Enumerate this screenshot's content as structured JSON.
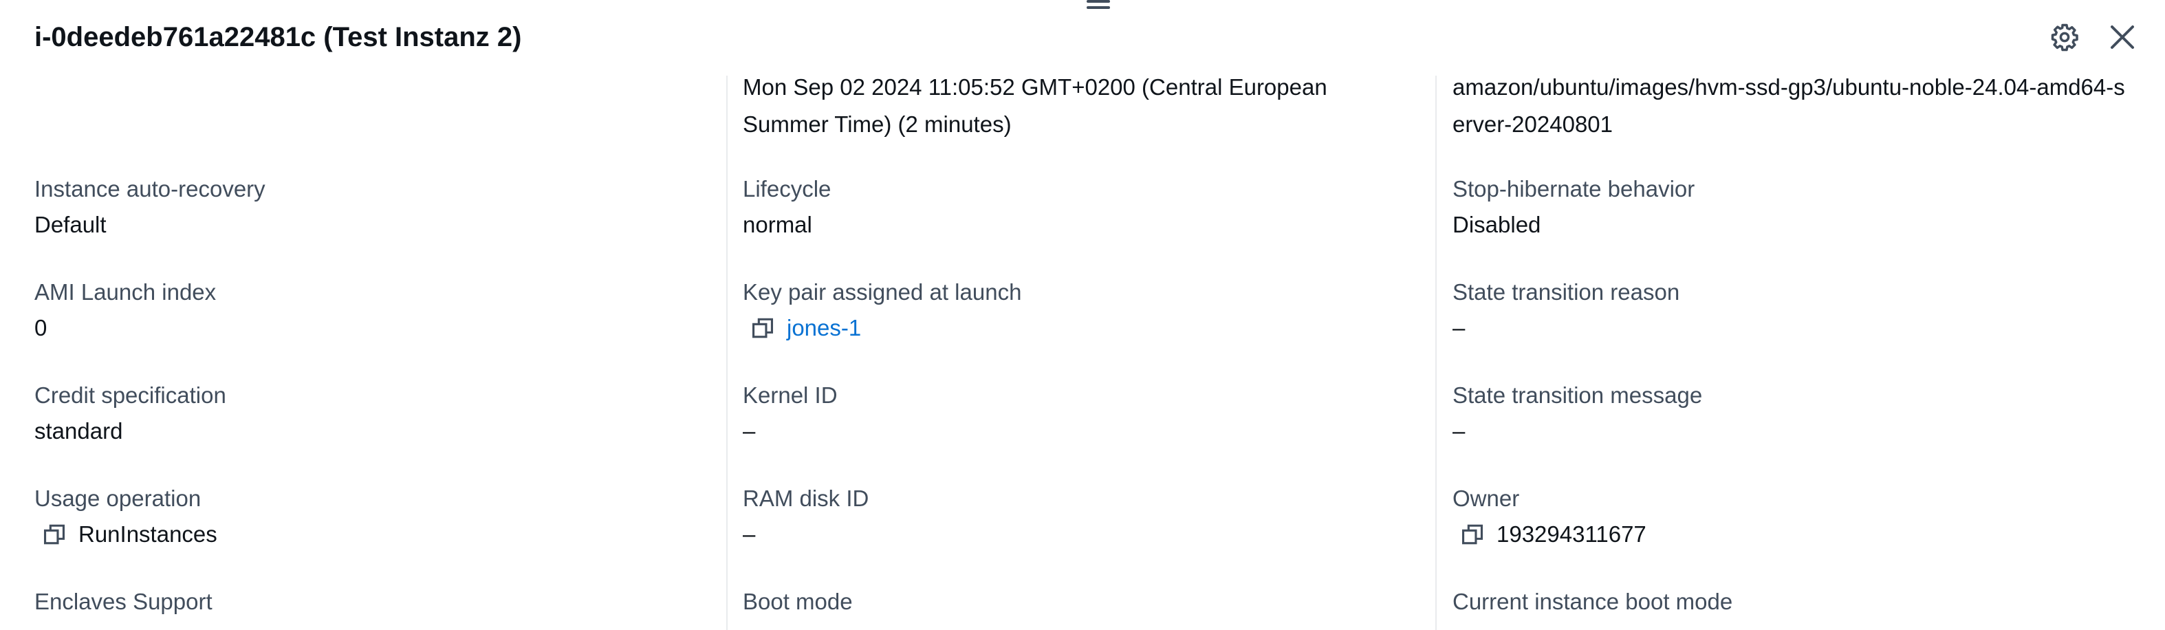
{
  "panel": {
    "title": "i-0deedeb761a22481c (Test Instanz 2)"
  },
  "columns": [
    {
      "fields": [
        {
          "label": "Instance auto-recovery",
          "value": "Default"
        },
        {
          "label": "AMI Launch index",
          "value": "0"
        },
        {
          "label": "Credit specification",
          "value": "standard"
        },
        {
          "label": "Usage operation",
          "value": "RunInstances"
        },
        {
          "label": "Enclaves Support",
          "value": ""
        }
      ]
    },
    {
      "top_value": "Mon Sep 02 2024 11:05:52 GMT+0200 (Central European Summer Time) (2 minutes)",
      "fields": [
        {
          "label": "Lifecycle",
          "value": "normal"
        },
        {
          "label": "Key pair assigned at launch",
          "value": "jones-1"
        },
        {
          "label": "Kernel ID",
          "value": "–"
        },
        {
          "label": "RAM disk ID",
          "value": "–"
        },
        {
          "label": "Boot mode",
          "value": ""
        }
      ]
    },
    {
      "top_value": "amazon/ubuntu/images/hvm-ssd-gp3/ubuntu-noble-24.04-amd64-server-20240801",
      "fields": [
        {
          "label": "Stop-hibernate behavior",
          "value": "Disabled"
        },
        {
          "label": "State transition reason",
          "value": "–"
        },
        {
          "label": "State transition message",
          "value": "–"
        },
        {
          "label": "Owner",
          "value": "193294311677"
        },
        {
          "label": "Current instance boot mode",
          "value": ""
        }
      ]
    }
  ],
  "icons": {
    "settings": "gear-icon",
    "close": "close-icon",
    "copy": "copy-icon",
    "drag": "drag-handle-icon"
  },
  "colors": {
    "text": "#0f141a",
    "label": "#414d5c",
    "link": "#0972d3",
    "divider": "#e9ebed"
  }
}
